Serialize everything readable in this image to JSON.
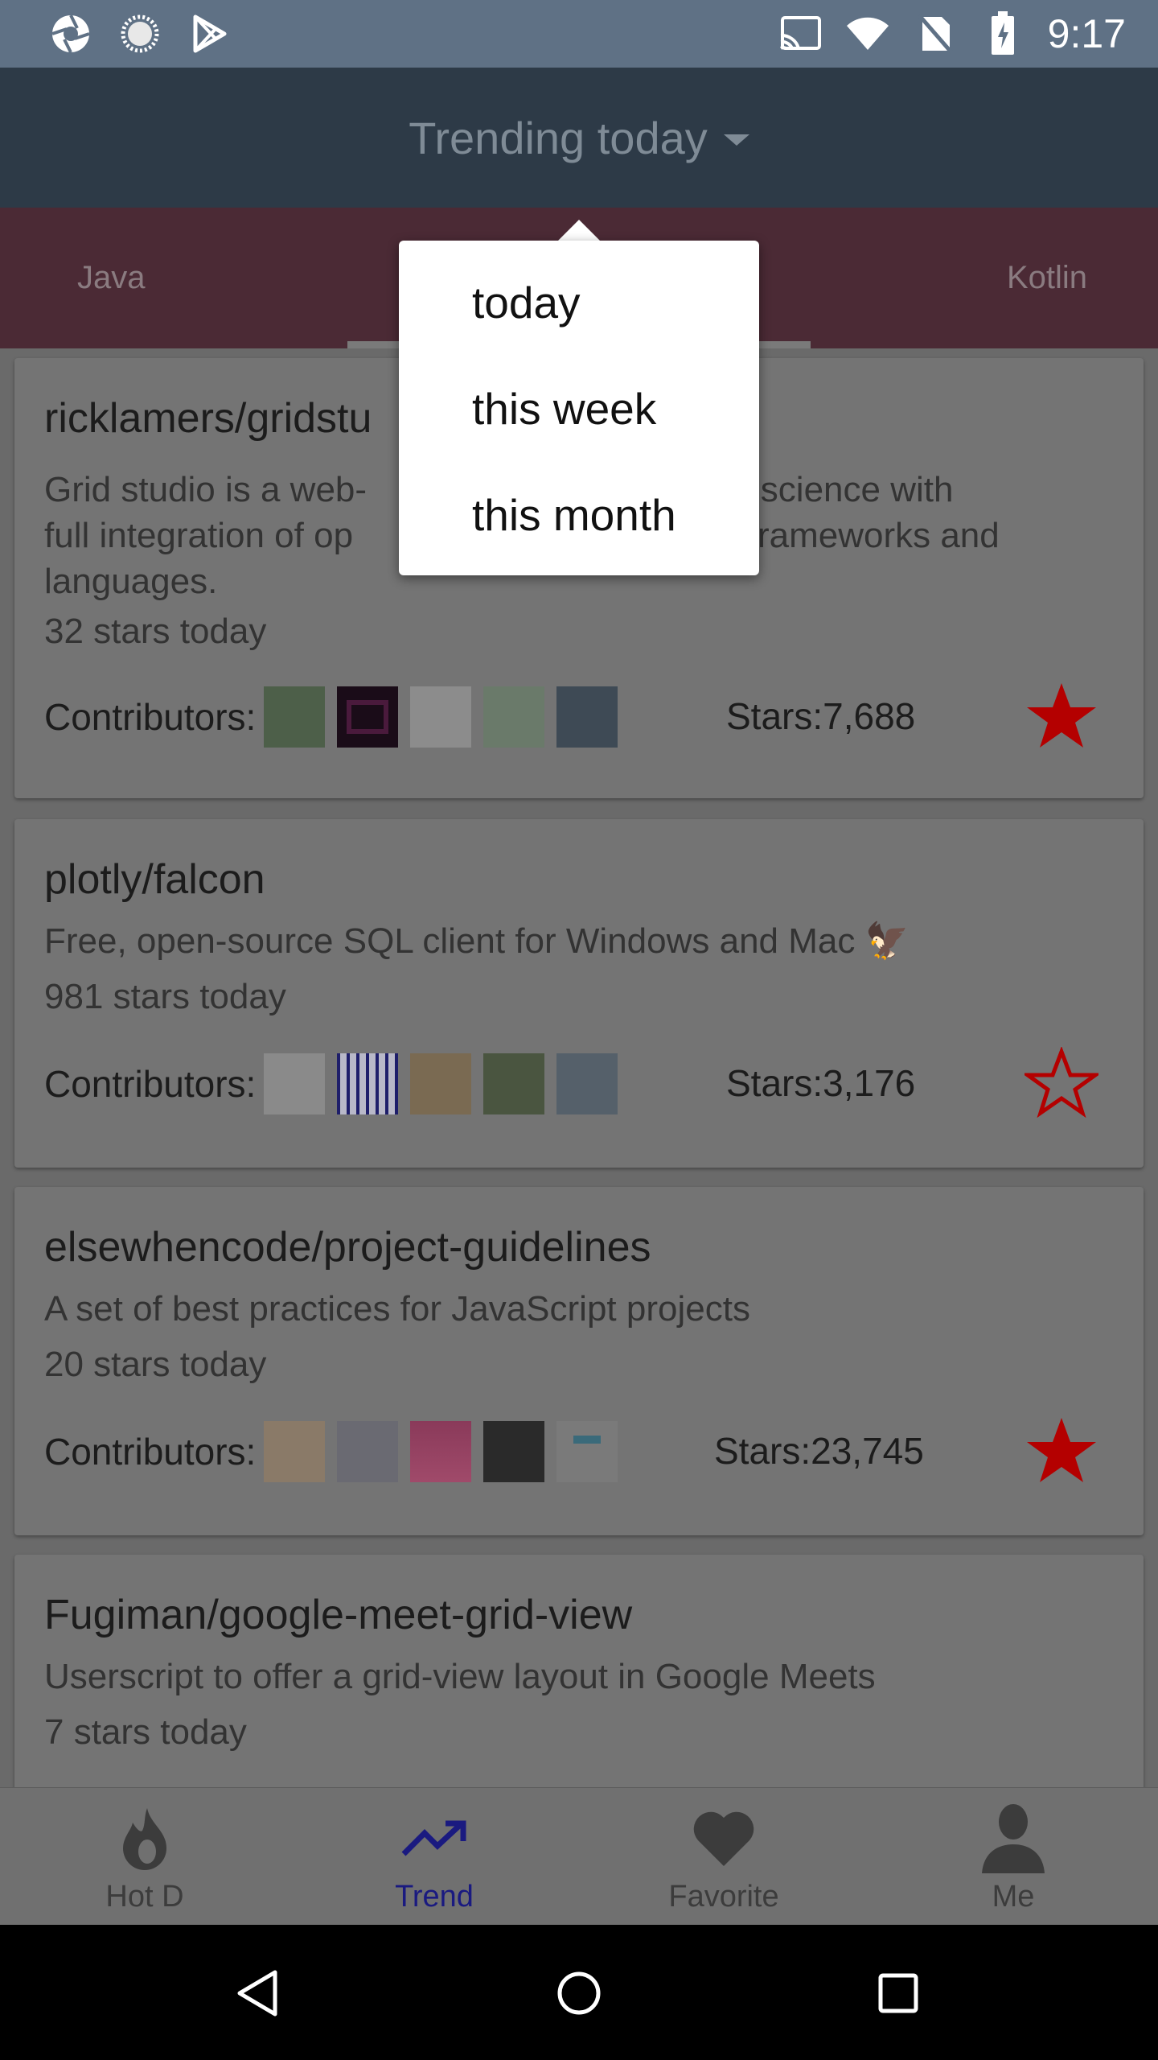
{
  "status_bar": {
    "time": "9:17",
    "left_icons": [
      "aperture-icon",
      "loading-circle-icon",
      "play-store-icon"
    ],
    "right_icons": [
      "cast-icon",
      "wifi-icon",
      "no-sim-icon",
      "battery-charging-icon"
    ]
  },
  "app_bar": {
    "title": "Trending today",
    "caret_icon": "dropdown-caret-icon"
  },
  "tabs": [
    {
      "label": "Java"
    },
    {
      "label": "Kotlin"
    }
  ],
  "dropdown": {
    "options": [
      "today",
      "this week",
      "this month"
    ]
  },
  "repos": [
    {
      "title": "ricklamers/gridstu",
      "desc_line1_a": "Grid studio is a web-",
      "desc_line1_b": "r data science with",
      "desc_line2_a": "full integration of op",
      "desc_line2_b": "ce frameworks and",
      "desc_line3": "languages.",
      "today": "32 stars today",
      "contributors_label": "Contributors:",
      "stars": "Stars:7,688",
      "starred": true
    },
    {
      "title": "plotly/falcon",
      "desc": "Free, open-source SQL client for Windows and Mac 🦅",
      "today": "981 stars today",
      "contributors_label": "Contributors:",
      "stars": "Stars:3,176",
      "starred": false
    },
    {
      "title": "elsewhencode/project-guidelines",
      "desc": "A set of best practices for JavaScript projects",
      "today": "20 stars today",
      "contributors_label": "Contributors:",
      "stars": "Stars:23,745",
      "starred": true
    },
    {
      "title": "Fugiman/google-meet-grid-view",
      "desc": "Userscript to offer a grid-view layout in Google Meets",
      "today": "7 stars today"
    }
  ],
  "bottom_nav": [
    {
      "label": "Hot D",
      "icon": "flame-icon",
      "active": false
    },
    {
      "label": "Trend",
      "icon": "trending-up-icon",
      "active": true
    },
    {
      "label": "Favorite",
      "icon": "heart-icon",
      "active": false
    },
    {
      "label": "Me",
      "icon": "person-icon",
      "active": false
    }
  ],
  "system_nav": [
    "back-icon",
    "home-icon",
    "recents-icon"
  ],
  "colors": {
    "star_red": "#b40000",
    "active_nav": "#1a1a80"
  }
}
